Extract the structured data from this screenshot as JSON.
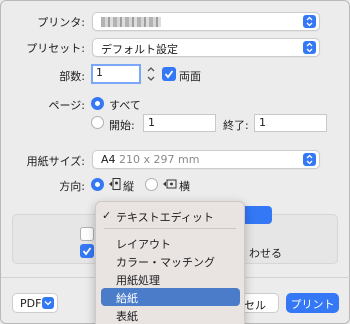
{
  "labels": {
    "printer": "プリンタ:",
    "presets": "プリセット:",
    "copies": "部数:",
    "pages": "ページ:",
    "paper_size": "用紙サイズ:",
    "orientation": "方向:"
  },
  "presets_value": "デフォルト設定",
  "copies_value": "1",
  "duplex_label": "両面",
  "pages": {
    "all_label": "すべて",
    "from_label": "開始:",
    "from_value": "1",
    "to_label": "終了:",
    "to_value": "1"
  },
  "paper_size": {
    "name": "A4",
    "dims": "210 x 297 mm"
  },
  "orientation": {
    "portrait": "縦",
    "landscape": "横"
  },
  "behind_menu_text": "わせる",
  "menu": {
    "items": [
      {
        "label": "テキストエディット",
        "checked": true
      },
      {
        "label": "レイアウト"
      },
      {
        "label": "カラー・マッチング"
      },
      {
        "label": "用紙処理"
      },
      {
        "label": "給紙",
        "selected": true
      },
      {
        "label": "表紙"
      }
    ]
  },
  "pdf_button": "PDF",
  "cancel_partial": "セル",
  "print_button": "プリント",
  "colors": {
    "accent": "#3478f6",
    "menu_bg": "#e9e3e2",
    "selected": "#4a7cc9"
  }
}
